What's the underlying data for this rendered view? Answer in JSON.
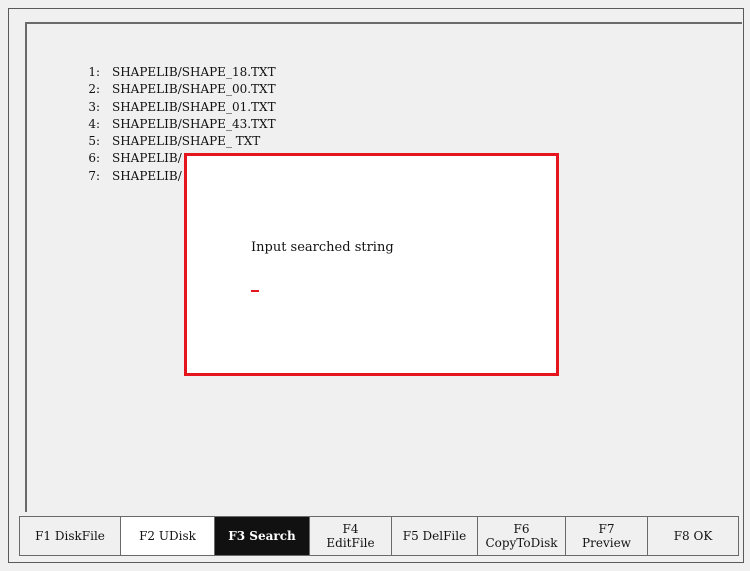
{
  "file_list": [
    {
      "num": "1:",
      "name": "SHAPELIB/SHAPE_18.TXT"
    },
    {
      "num": "2:",
      "name": "SHAPELIB/SHAPE_00.TXT"
    },
    {
      "num": "3:",
      "name": "SHAPELIB/SHAPE_01.TXT"
    },
    {
      "num": "4:",
      "name": "SHAPELIB/SHAPE_43.TXT"
    },
    {
      "num": "5:",
      "name": "SHAPELIB/SHAPE_ TXT"
    },
    {
      "num": "6:",
      "name": "SHAPELIB/"
    },
    {
      "num": "7:",
      "name": "SHAPELIB/"
    }
  ],
  "dialog": {
    "prompt": "Input searched string",
    "input_value": ""
  },
  "fkeys": [
    {
      "label": "F1 DiskFile"
    },
    {
      "label": "F2 UDisk"
    },
    {
      "label": "F3 Search"
    },
    {
      "label": "F4\nEditFile"
    },
    {
      "label": "F5 DelFile"
    },
    {
      "label": "F6\nCopyToDisk"
    },
    {
      "label": "F7\nPreview"
    },
    {
      "label": "F8 OK"
    }
  ],
  "colors": {
    "dialog_border": "#e4151c",
    "active_key_bg": "#111111"
  }
}
